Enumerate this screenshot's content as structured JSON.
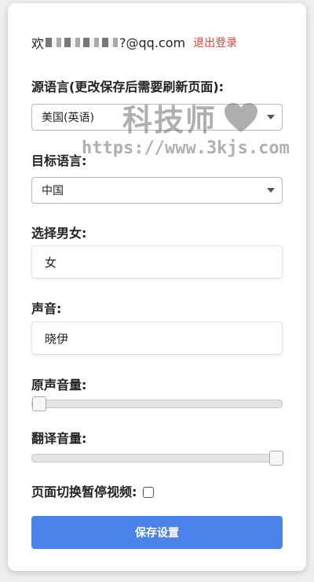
{
  "header": {
    "greeting_prefix": "欢",
    "email_suffix": "?@qq.com",
    "logout_label": "退出登录"
  },
  "source_language": {
    "label": "源语言(更改保存后需要刷新页面):",
    "value": "美国(英语)"
  },
  "target_language": {
    "label": "目标语言:",
    "value": "中国"
  },
  "gender": {
    "label": "选择男女:",
    "value": "女"
  },
  "voice": {
    "label": "声音:",
    "value": "晓伊"
  },
  "original_volume": {
    "label": "原声音量:",
    "level": 0
  },
  "translation_volume": {
    "label": "翻译音量:",
    "level": 1
  },
  "pause_on_switch": {
    "label": "页面切换暂停视频:",
    "checked": false
  },
  "save_button": {
    "label": "保存设置"
  },
  "watermark": {
    "brand": "科技师",
    "url": "https://www.3kjs.com"
  },
  "colors": {
    "accent": "#4a83ea",
    "logout": "#d9443a"
  }
}
